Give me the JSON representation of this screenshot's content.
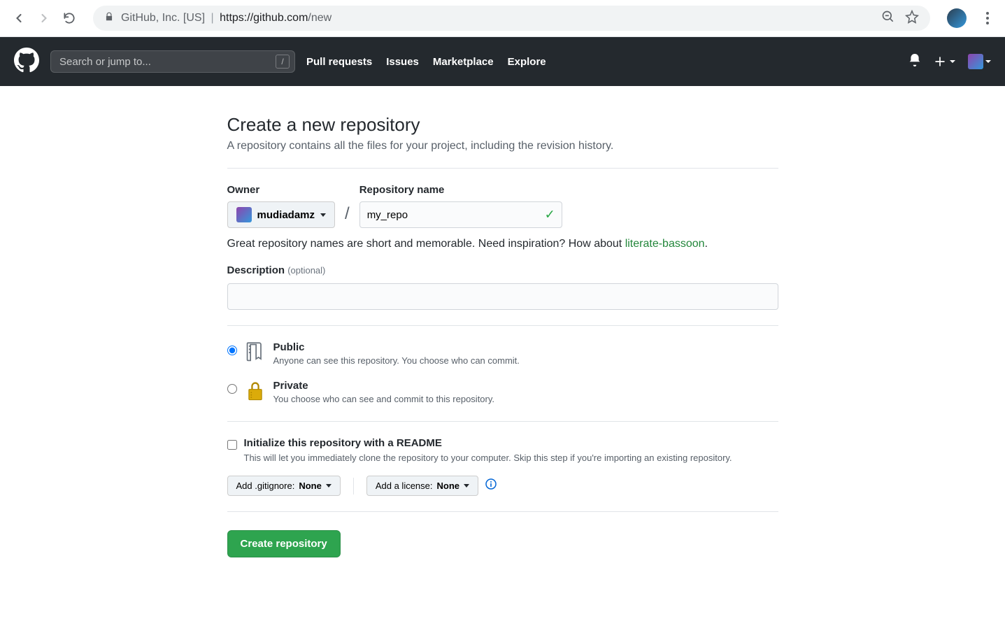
{
  "browser": {
    "org": "GitHub, Inc. [US]",
    "url_host": "https://github.com",
    "url_path": "/new"
  },
  "gh_header": {
    "search_placeholder": "Search or jump to...",
    "nav": [
      "Pull requests",
      "Issues",
      "Marketplace",
      "Explore"
    ]
  },
  "page": {
    "title": "Create a new repository",
    "subtitle": "A repository contains all the files for your project, including the revision history."
  },
  "form": {
    "owner_label": "Owner",
    "owner_value": "mudiadamz",
    "repo_label": "Repository name",
    "repo_value": "my_repo",
    "hint_prefix": "Great repository names are short and memorable. Need inspiration? How about ",
    "hint_suggestion": "literate-bassoon",
    "hint_suffix": ".",
    "desc_label": "Description",
    "desc_optional": "(optional)",
    "desc_value": "",
    "public_title": "Public",
    "public_desc": "Anyone can see this repository. You choose who can commit.",
    "private_title": "Private",
    "private_desc": "You choose who can see and commit to this repository.",
    "init_title": "Initialize this repository with a README",
    "init_desc": "This will let you immediately clone the repository to your computer. Skip this step if you're importing an existing repository.",
    "gitignore_label": "Add .gitignore:",
    "gitignore_value": "None",
    "license_label": "Add a license:",
    "license_value": "None",
    "submit": "Create repository"
  }
}
